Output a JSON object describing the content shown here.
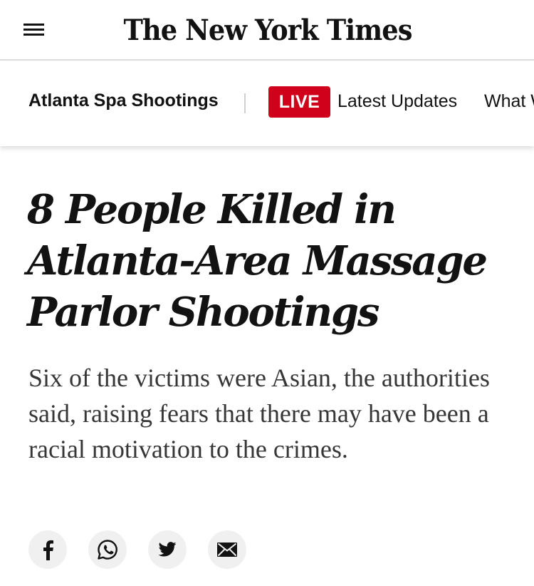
{
  "masthead": {
    "logo": "The New York Times",
    "menu_icon": "hamburger-menu-icon"
  },
  "subnav": {
    "section": "Atlanta Spa Shootings",
    "live_label": "LIVE",
    "live_color": "#d0021b",
    "links": [
      "Latest Updates",
      "What W"
    ]
  },
  "article": {
    "headline": "8 People Killed in Atlanta-Area Massage Parlor Shootings",
    "summary": "Six of the victims were Asian, the authorities said, raising fears that there may have been a racial motivation to the crimes."
  },
  "share": {
    "icons": [
      "facebook-icon",
      "whatsapp-icon",
      "twitter-icon",
      "email-icon"
    ]
  }
}
